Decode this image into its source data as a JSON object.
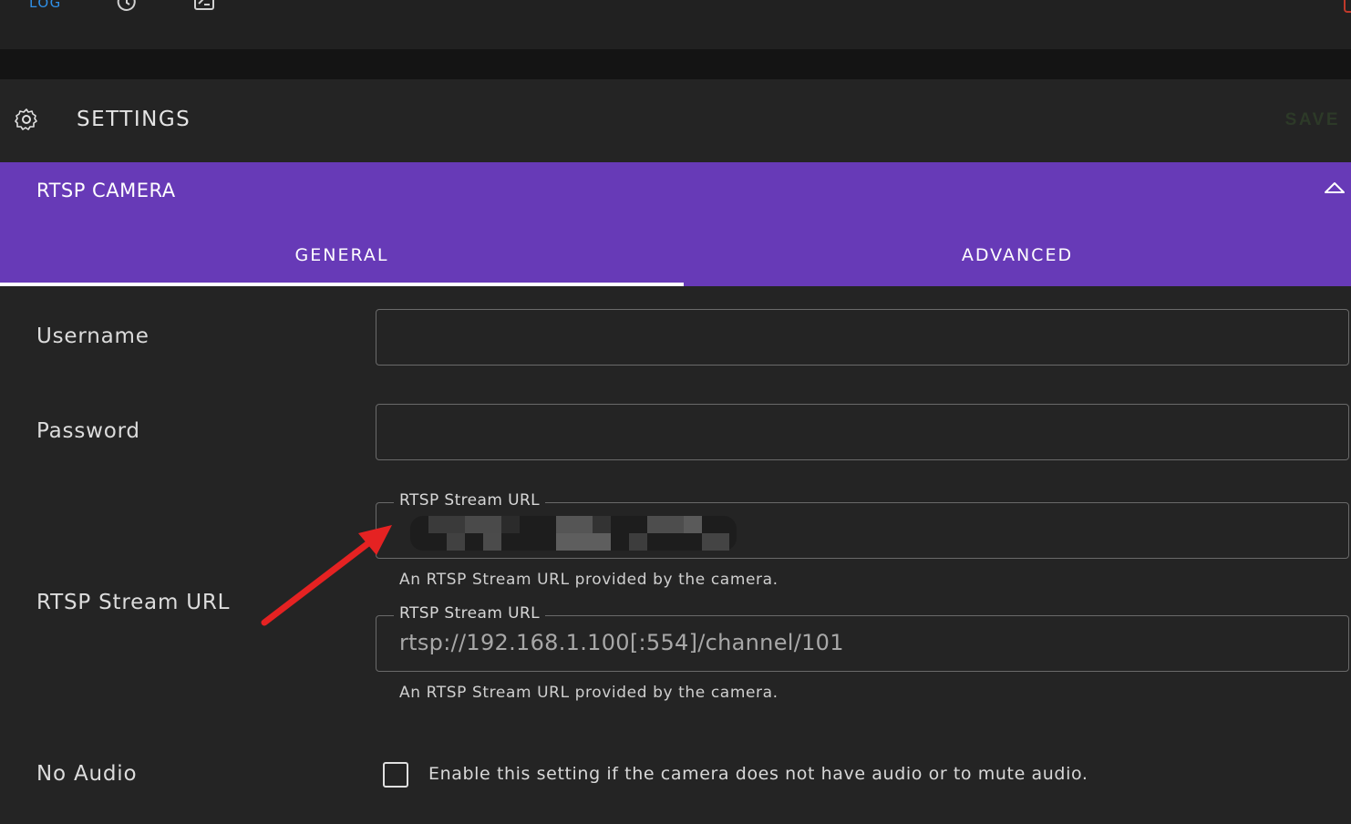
{
  "topbar": {
    "log_label": "LOG",
    "icons": [
      "history-icon",
      "terminal-icon"
    ]
  },
  "settings": {
    "title": "SETTINGS",
    "save_label": "SAVE",
    "icon": "gear-icon"
  },
  "panel": {
    "title": "RTSP CAMERA",
    "collapse_icon": "chevron-up-icon",
    "accent_color": "#673ab7",
    "tabs": [
      {
        "label": "GENERAL",
        "active": true
      },
      {
        "label": "ADVANCED",
        "active": false
      }
    ]
  },
  "form": {
    "username": {
      "label": "Username",
      "value": ""
    },
    "password": {
      "label": "Password",
      "value": ""
    },
    "rtsp": {
      "label": "RTSP Stream URL",
      "field1": {
        "float_label": "RTSP Stream URL",
        "value_redacted": true,
        "helper": "An RTSP Stream URL provided by the camera."
      },
      "field2": {
        "float_label": "RTSP Stream URL",
        "placeholder": "rtsp://192.168.1.100[:554]/channel/101",
        "helper": "An RTSP Stream URL provided by the camera."
      }
    },
    "no_audio": {
      "label": "No Audio",
      "checked": false,
      "description": "Enable this setting if the camera does not have audio or to mute audio."
    }
  },
  "annotation": {
    "arrow_color": "#e52222"
  }
}
